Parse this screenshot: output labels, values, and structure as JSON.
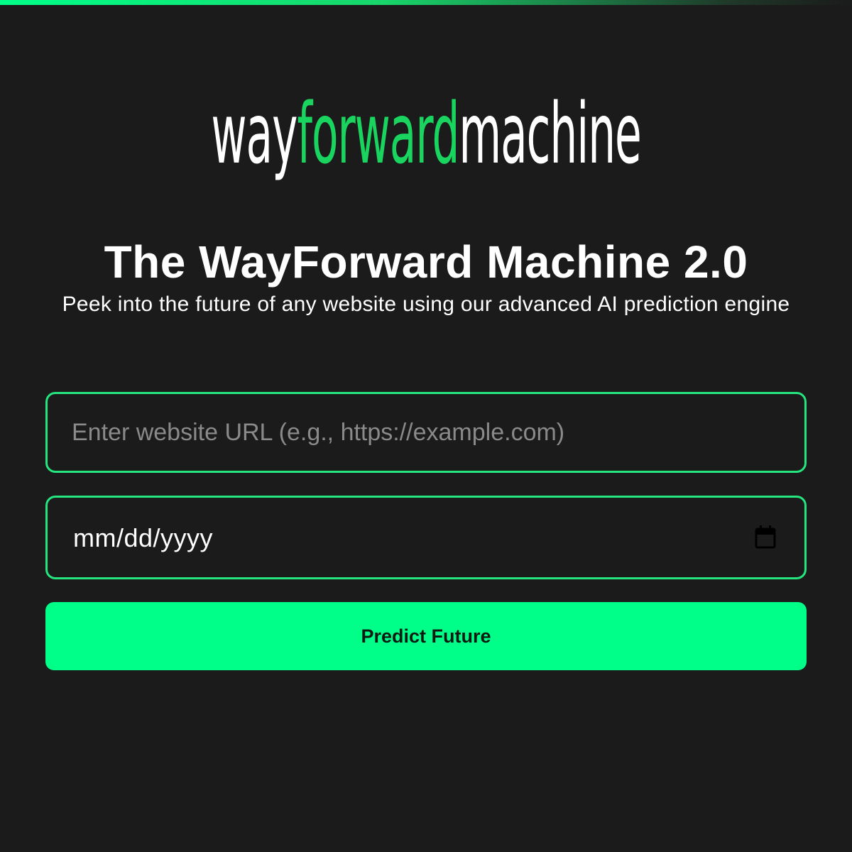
{
  "logo": {
    "part1": "way",
    "part2": "forward",
    "part3": "machine",
    "accent_color": "#19d45e"
  },
  "header": {
    "title": "The WayForward Machine 2.0",
    "subtitle": "Peek into the future of any website using our advanced AI prediction engine"
  },
  "form": {
    "url_placeholder": "Enter website URL (e.g., https://example.com)",
    "url_value": "",
    "date_placeholder": "mm/dd/yyyy",
    "date_icon": "calendar-icon",
    "submit_label": "Predict Future"
  },
  "colors": {
    "background": "#1b1b1b",
    "accent": "#00ff88",
    "field_border": "#25e57f"
  }
}
